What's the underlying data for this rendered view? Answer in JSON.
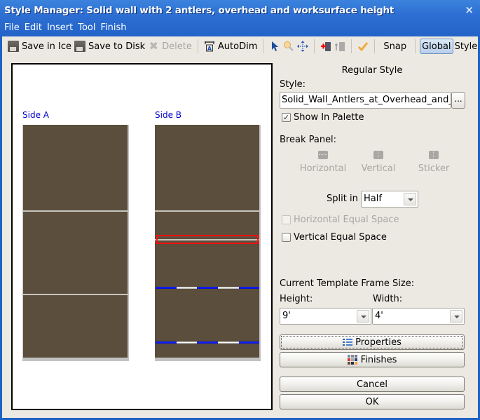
{
  "window": {
    "title": "Style Manager: Solid wall with 2 antlers, overhead and worksurface height",
    "close_icon": "×"
  },
  "menu": [
    "File",
    "Edit",
    "Insert",
    "Tool",
    "Finish"
  ],
  "toolbar": {
    "save_in_ice": "Save in Ice",
    "save_to_disk": "Save to Disk",
    "delete": "Delete",
    "autodim": "AutoDim",
    "snap": "Snap",
    "global": "Global",
    "style": "Style",
    "icons": [
      "floppy-icon",
      "floppy-icon",
      "delete-x-icon",
      "autodim-icon",
      "pointer-icon",
      "zoom-icon",
      "pan-icon",
      "add-panel-icon",
      "panel-icon",
      "checkmark-icon"
    ]
  },
  "canvas": {
    "side_a_label": "Side A",
    "side_b_label": "Side B",
    "panel_color": "#5b4e3c",
    "selection_color": "#ff1010",
    "antler_color": "#1020ff"
  },
  "right_panel": {
    "heading": "Regular Style",
    "style_label": "Style:",
    "style_value": "Solid_Wall_Antlers_at_Overhead_and_Worksurface",
    "browse_button": "...",
    "show_in_palette": {
      "label": "Show In Palette",
      "checked": true
    },
    "break_panel_label": "Break Panel:",
    "break_panel_options": [
      "Horizontal",
      "Vertical",
      "Sticker"
    ],
    "split_in_label": "Split in",
    "split_in_value": "Half",
    "horizontal_equal_space": {
      "label": "Horizontal Equal Space",
      "checked": false,
      "enabled": false
    },
    "vertical_equal_space": {
      "label": "Vertical Equal Space",
      "checked": false,
      "enabled": true
    },
    "frame_size_label": "Current Template Frame Size:",
    "height_label": "Height:",
    "height_value": "9'",
    "width_label": "Width:",
    "width_value": "4'",
    "properties_button": "Properties",
    "finishes_button": "Finishes",
    "cancel_button": "Cancel",
    "ok_button": "OK"
  }
}
